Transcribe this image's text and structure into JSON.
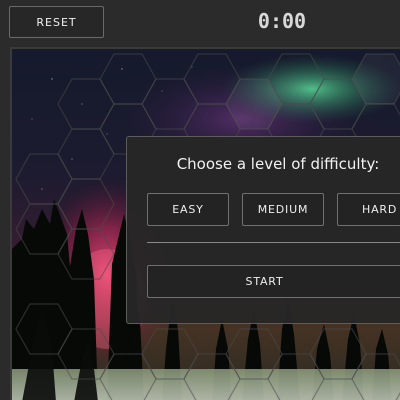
{
  "toolbar": {
    "reset_label": "RESET",
    "timer": "0:00"
  },
  "dialog": {
    "title": "Choose a level of difficulty:",
    "levels": [
      "EASY",
      "MEDIUM",
      "HARD"
    ],
    "start_label": "START"
  },
  "colors": {
    "app_background": "#2b2b2b",
    "panel_background": "#262626",
    "button_border": "#707070",
    "aurora_pink": "#e0406a",
    "aurora_green": "#4cd98a",
    "night_sky": "#141a2c"
  },
  "board": {
    "tile_shape": "hexagon",
    "background": "aurora-forest-night"
  }
}
